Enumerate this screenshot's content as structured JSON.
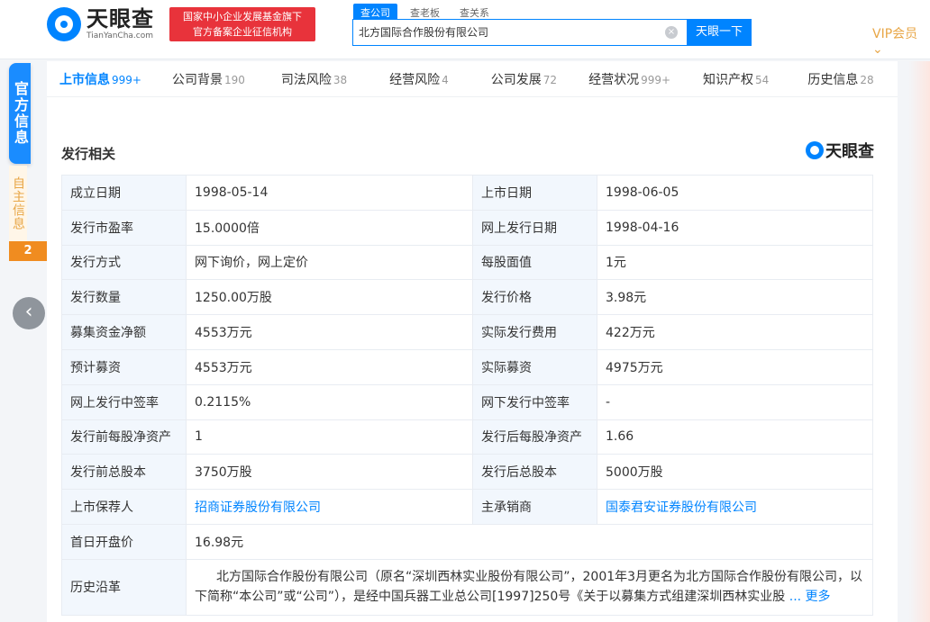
{
  "header": {
    "logo_cn": "天眼查",
    "logo_en": "TianYanCha.com",
    "slogan_line1": "国家中小企业发展基金旗下",
    "slogan_line2": "官方备案企业征信机构",
    "search_tabs": [
      "查公司",
      "查老板",
      "查关系"
    ],
    "search_value": "北方国际合作股份有限公司",
    "search_button": "天眼一下",
    "vip": "VIP会员"
  },
  "side": {
    "official": "官方信息",
    "self": "自主信息",
    "badge": "2"
  },
  "nav": [
    {
      "label": "上市信息",
      "count": "999+"
    },
    {
      "label": "公司背景",
      "count": "190"
    },
    {
      "label": "司法风险",
      "count": "38"
    },
    {
      "label": "经营风险",
      "count": "4"
    },
    {
      "label": "公司发展",
      "count": "72"
    },
    {
      "label": "经营状况",
      "count": "999+"
    },
    {
      "label": "知识产权",
      "count": "54"
    },
    {
      "label": "历史信息",
      "count": "28"
    }
  ],
  "section": {
    "title": "发行相关",
    "brand": "天眼查"
  },
  "rows": [
    {
      "k1": "成立日期",
      "v1": "1998-05-14",
      "k2": "上市日期",
      "v2": "1998-06-05"
    },
    {
      "k1": "发行市盈率",
      "v1": "15.0000倍",
      "k2": "网上发行日期",
      "v2": "1998-04-16"
    },
    {
      "k1": "发行方式",
      "v1": "网下询价，网上定价",
      "k2": "每股面值",
      "v2": "1元"
    },
    {
      "k1": "发行数量",
      "v1": "1250.00万股",
      "k2": "发行价格",
      "v2": "3.98元"
    },
    {
      "k1": "募集资金净额",
      "v1": "4553万元",
      "k2": "实际发行费用",
      "v2": "422万元"
    },
    {
      "k1": "预计募资",
      "v1": "4553万元",
      "k2": "实际募资",
      "v2": "4975万元"
    },
    {
      "k1": "网上发行中签率",
      "v1": "0.2115%",
      "k2": "网下发行中签率",
      "v2": "-"
    },
    {
      "k1": "发行前每股净资产",
      "v1": "1",
      "k2": "发行后每股净资产",
      "v2": "1.66"
    },
    {
      "k1": "发行前总股本",
      "v1": "3750万股",
      "k2": "发行后总股本",
      "v2": "5000万股"
    },
    {
      "k1": "上市保荐人",
      "v1": "招商证券股份有限公司",
      "k2": "主承销商",
      "v2": "国泰君安证券股份有限公司"
    }
  ],
  "first_day": {
    "k": "首日开盘价",
    "v": "16.98元"
  },
  "history": {
    "k": "历史沿革",
    "v": "北方国际合作股份有限公司（原名“深圳西林实业股份有限公司”，2001年3月更名为北方国际合作股份有限公司，以下简称“本公司”或“公司”），是经中国兵器工业总公司[1997]250号《关于以募集方式组建深圳西林实业股",
    "more": "... 更多"
  }
}
